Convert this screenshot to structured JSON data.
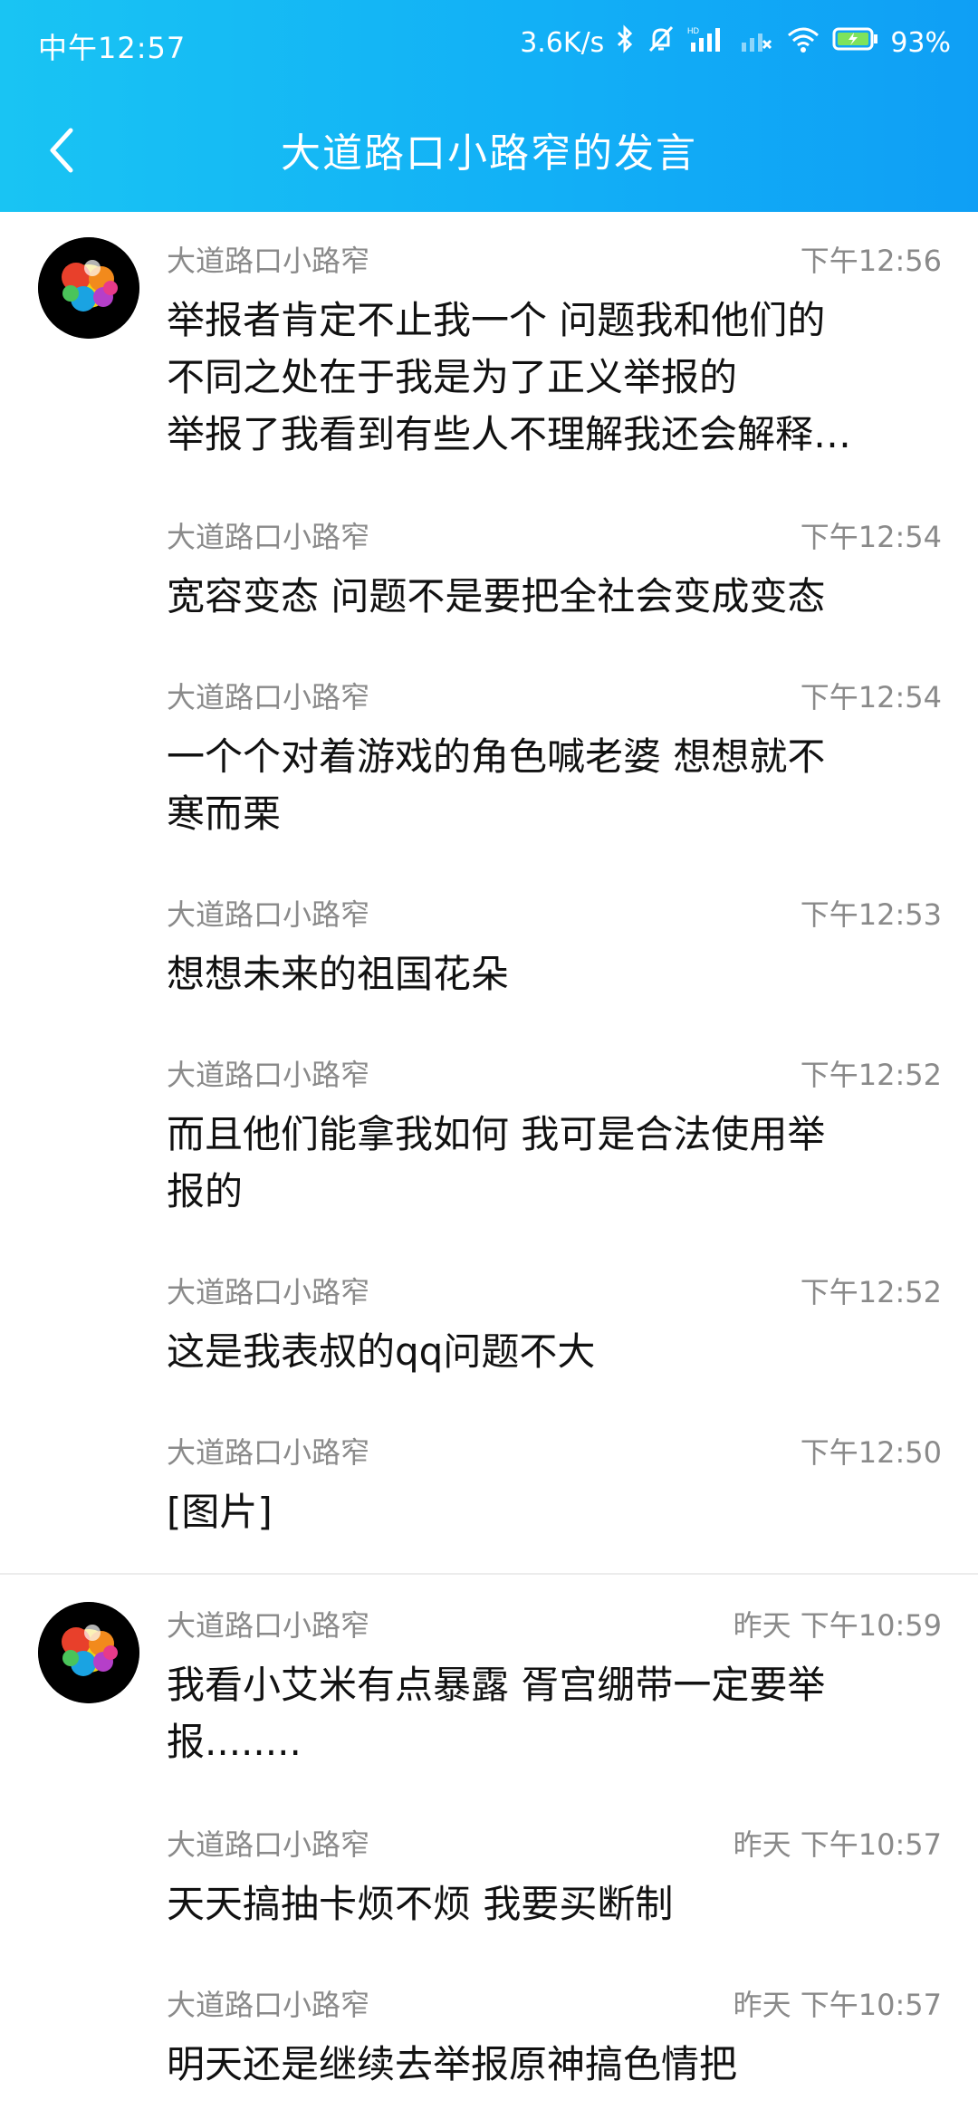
{
  "status": {
    "time": "中午12:57",
    "speed": "3.6K/s",
    "battery": "93%",
    "icons": [
      "bluetooth-icon",
      "mute-bell-icon",
      "hd-signal-icon",
      "signal-off-icon",
      "wifi-icon",
      "battery-charging-icon"
    ]
  },
  "header": {
    "title": "大道路口小路窄的发言",
    "back_icon": "chevron-left-icon"
  },
  "groups": [
    {
      "messages": [
        {
          "author": "大道路口小路窄",
          "time": "下午12:56",
          "text": "举报者肯定不止我一个 问题我和他们的\n不同之处在于我是为了正义举报的\n举报了我看到有些人不理解我还会解释…"
        },
        {
          "author": "大道路口小路窄",
          "time": "下午12:54",
          "text": "宽容变态 问题不是要把全社会变成变态"
        },
        {
          "author": "大道路口小路窄",
          "time": "下午12:54",
          "text": "一个个对着游戏的角色喊老婆 想想就不\n寒而栗"
        },
        {
          "author": "大道路口小路窄",
          "time": "下午12:53",
          "text": "想想未来的祖国花朵"
        },
        {
          "author": "大道路口小路窄",
          "time": "下午12:52",
          "text": "而且他们能拿我如何 我可是合法使用举\n报的"
        },
        {
          "author": "大道路口小路窄",
          "time": "下午12:52",
          "text": "这是我表叔的qq问题不大"
        },
        {
          "author": "大道路口小路窄",
          "time": "下午12:50",
          "text": "[图片]"
        }
      ]
    },
    {
      "messages": [
        {
          "author": "大道路口小路窄",
          "time": "昨天 下午10:59",
          "text": "我看小艾米有点暴露 胥宫绷带一定要举\n报........"
        },
        {
          "author": "大道路口小路窄",
          "time": "昨天 下午10:57",
          "text": "天天搞抽卡烦不烦 我要买断制"
        },
        {
          "author": "大道路口小路窄",
          "time": "昨天 下午10:57",
          "text": "明天还是继续去举报原神搞色情把"
        }
      ]
    }
  ]
}
